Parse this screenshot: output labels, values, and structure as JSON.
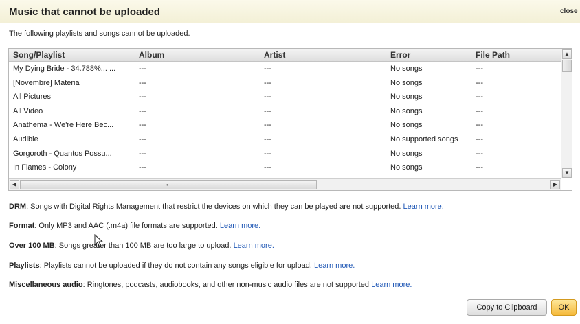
{
  "dialog": {
    "title": "Music that cannot be uploaded",
    "close_label": "close",
    "intro": "The following playlists and songs cannot be uploaded."
  },
  "table": {
    "columns": [
      "Song/Playlist",
      "Album",
      "Artist",
      "Error",
      "File Path"
    ],
    "rows": [
      [
        "My Dying Bride - 34.788%... ...",
        "---",
        "---",
        "No songs",
        "---"
      ],
      [
        "[Novembre] Materia",
        "---",
        "---",
        "No songs",
        "---"
      ],
      [
        "All Pictures",
        "---",
        "---",
        "No songs",
        "---"
      ],
      [
        "All Video",
        "---",
        "---",
        "No songs",
        "---"
      ],
      [
        "Anathema - We're Here Bec...",
        "---",
        "---",
        "No songs",
        "---"
      ],
      [
        "Audible",
        "---",
        "---",
        "No supported songs",
        "---"
      ],
      [
        "Gorgoroth - Quantos Possu...",
        "---",
        "---",
        "No songs",
        "---"
      ],
      [
        "In Flames - Colony",
        "---",
        "---",
        "No songs",
        "---"
      ]
    ]
  },
  "info": {
    "drm": {
      "term": "DRM",
      "text": ": Songs with Digital Rights Management that restrict the devices on which they can be played are not supported.",
      "link": "Learn more."
    },
    "format": {
      "term": "Format",
      "text": ": Only MP3 and AAC (.m4a) file formats are supported.",
      "link": "Learn more."
    },
    "over100": {
      "term": "Over 100 MB",
      "text": ": Songs greater than 100 MB are too large to upload.",
      "link": "Learn more."
    },
    "playlists": {
      "term": "Playlists",
      "text": ": Playlists cannot be uploaded if they do not contain any songs eligible for upload.",
      "link": "Learn more."
    },
    "misc": {
      "term": "Miscellaneous audio",
      "text": ": Ringtones, podcasts, audiobooks, and other non-music audio files are not supported",
      "link": "Learn more."
    }
  },
  "buttons": {
    "copy": "Copy to Clipboard",
    "ok": "OK"
  },
  "icons": {
    "scroll_up": "▲",
    "scroll_down": "▼",
    "scroll_left": "◀",
    "scroll_right": "▶",
    "scroll_grip": "•"
  }
}
